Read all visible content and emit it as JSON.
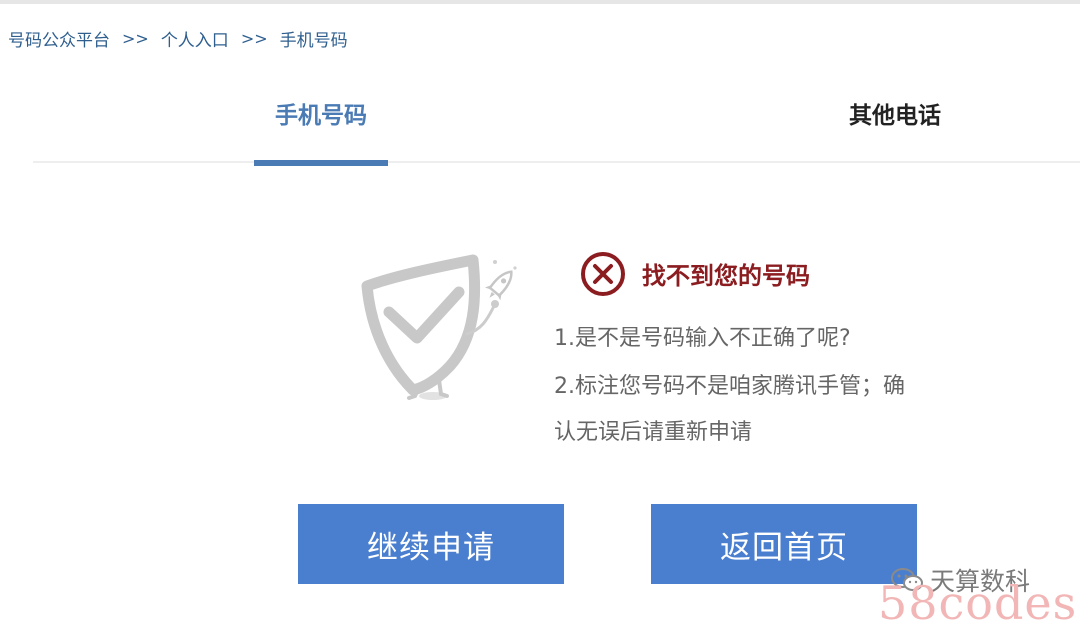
{
  "breadcrumb": {
    "items": [
      "号码公众平台",
      "个人入口",
      "手机号码"
    ],
    "separator": ">>"
  },
  "tabs": [
    {
      "label": "手机号码",
      "active": true
    },
    {
      "label": "其他电话",
      "active": false
    }
  ],
  "result": {
    "icon": "error-circle-x-icon",
    "title": "找不到您的号码",
    "tips": [
      "1.是不是号码输入不正确了呢?",
      "2.标注您号码不是咱家腾讯手管；确",
      "认无误后请重新申请"
    ]
  },
  "buttons": {
    "continue_label": "继续申请",
    "home_label": "返回首页"
  },
  "watermark": {
    "icon": "wechat-icon",
    "account": "天算数科",
    "site": "58codes"
  },
  "colors": {
    "accent_blue": "#4a7bb5",
    "button_blue": "#4a7fcf",
    "error_red": "#8b1d20",
    "breadcrumb_blue": "#2f5f8f"
  }
}
